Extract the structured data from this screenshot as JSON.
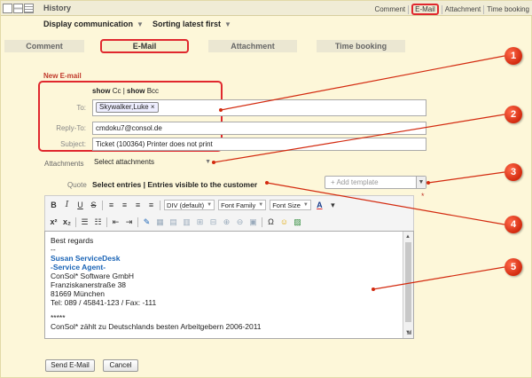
{
  "history": {
    "title": "History",
    "links": [
      "Comment",
      "E-Mail",
      "Attachment",
      "Time booking"
    ],
    "active_link": "E-Mail"
  },
  "subbar": {
    "display": "Display communication",
    "sorting": "Sorting latest first"
  },
  "tabs": [
    {
      "label": "Comment",
      "active": false
    },
    {
      "label": "E-Mail",
      "active": true
    },
    {
      "label": "Attachment",
      "active": false
    },
    {
      "label": "Time booking",
      "active": false
    }
  ],
  "form": {
    "section_title": "New E-mail",
    "show_cc": "show",
    "cc": "Cc",
    "show_bcc": "show",
    "bcc": "Bcc",
    "to_label": "To:",
    "to_chip": "Skywalker,Luke",
    "reply_to_label": "Reply-To:",
    "reply_to_value": "cmdoku7@consol.de",
    "subject_label": "Subject:",
    "subject_value": "Ticket (100364) Printer does not print",
    "attachments_label": "Attachments",
    "attachments_value": "Select attachments",
    "quote_label": "Quote",
    "quote_value": "Select entries",
    "quote_visible": "Entries visible to the customer",
    "template_placeholder": "+ Add template"
  },
  "toolbar": {
    "format": "DIV (default)",
    "font_family": "Font Family",
    "font_size": "Font Size"
  },
  "editor": {
    "lines": [
      {
        "text": "Best regards",
        "style": "normal"
      },
      {
        "text": "--",
        "style": "normal"
      },
      {
        "text": "Susan ServiceDesk",
        "style": "blue"
      },
      {
        "text": "-Service Agent-",
        "style": "blue"
      },
      {
        "text": "ConSol* Software GmbH",
        "style": "normal"
      },
      {
        "text": "Franziskanerstraße 38",
        "style": "normal"
      },
      {
        "text": "81669 München",
        "style": "normal"
      },
      {
        "text": "Tel: 089 / 45841-123 / Fax: -111",
        "style": "normal"
      },
      {
        "text": "",
        "style": "gap"
      },
      {
        "text": "*****",
        "style": "normal"
      },
      {
        "text": "ConSol* zählt zu Deutschlands besten Arbeitgebern 2006-2011",
        "style": "normal"
      }
    ]
  },
  "buttons": {
    "send": "Send E-Mail",
    "cancel": "Cancel"
  },
  "callouts": [
    "1",
    "2",
    "3",
    "4",
    "5"
  ],
  "colors": {
    "highlight": "#e0282e",
    "callout": "#d32a0f",
    "section_title": "#c0392b",
    "signature_blue": "#1a64b6",
    "background": "#fdf7d9"
  }
}
